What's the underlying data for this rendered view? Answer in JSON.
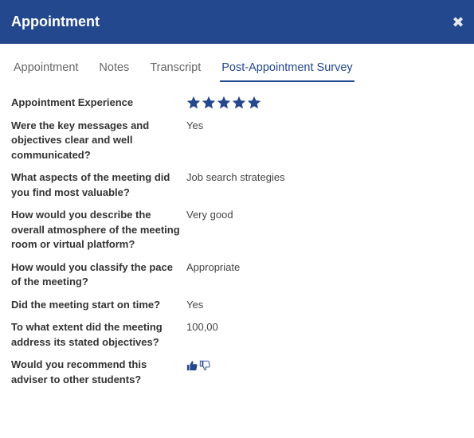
{
  "window": {
    "title": "Appointment",
    "close_icon": "close-icon",
    "accent_color": "#23488d"
  },
  "tabs": [
    {
      "label": "Appointment",
      "active": false
    },
    {
      "label": "Notes",
      "active": false
    },
    {
      "label": "Transcript",
      "active": false
    },
    {
      "label": "Post-Appointment Survey",
      "active": true
    }
  ],
  "survey": {
    "experience": {
      "question": "Appointment Experience",
      "rating": 5,
      "max_rating": 5,
      "icon": "star-icon"
    },
    "items": [
      {
        "question": "Were the key messages and objectives clear and well communicated?",
        "answer": "Yes"
      },
      {
        "question": "What aspects of the meeting did you find most valuable?",
        "answer": "Job search strategies"
      },
      {
        "question": "How would you describe the overall atmosphere of the meeting room or virtual platform?",
        "answer": "Very good"
      },
      {
        "question": "How would you classify the pace of the meeting?",
        "answer": "Appropriate"
      },
      {
        "question": "Did the meeting start on time?",
        "answer": "Yes"
      },
      {
        "question": "To what extent did the meeting address its stated objectives?",
        "answer": "100,00"
      }
    ],
    "recommend": {
      "question": "Would you recommend this adviser to other students?",
      "selected": "thumbs-up",
      "icons": [
        "thumbs-up-icon",
        "thumbs-down-icon"
      ]
    }
  }
}
